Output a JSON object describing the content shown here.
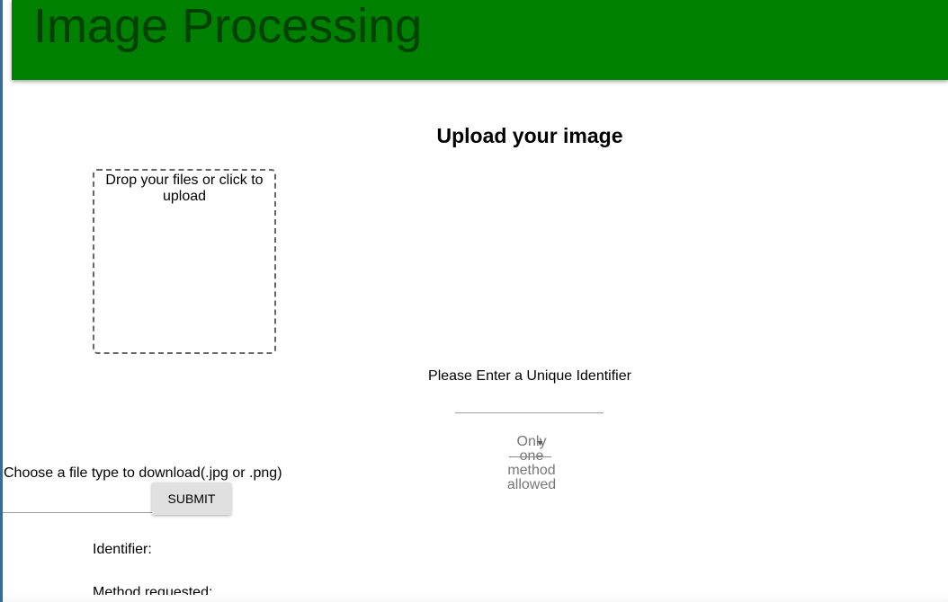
{
  "header": {
    "title": "Image Processing"
  },
  "upload": {
    "heading": "Upload your image",
    "dropzone_text": "Drop your files or click to upload"
  },
  "identifier": {
    "label": "Please Enter a Unique Identifier",
    "value": ""
  },
  "method": {
    "placeholder": "Only one method allowed"
  },
  "download": {
    "label": "Choose a file type to download(.jpg or .png)",
    "value": "",
    "submit_label": "SUBMIT"
  },
  "results": {
    "identifier_label": "Identifier:",
    "method_label": "Method requested:"
  },
  "colors": {
    "app_bar": "#008000",
    "title_text": "#004000"
  }
}
